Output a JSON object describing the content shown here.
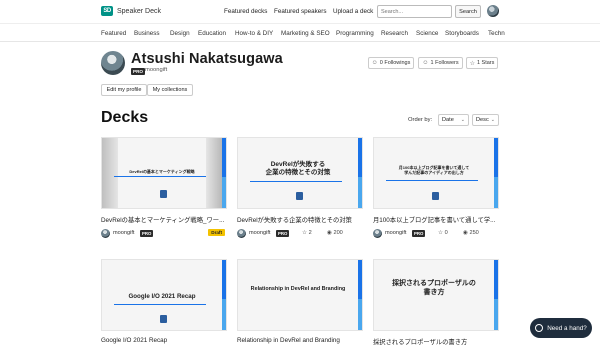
{
  "header": {
    "logo_mark": "SD",
    "logo_text": "Speaker Deck",
    "links": [
      "Featured decks",
      "Featured speakers",
      "Upload a deck"
    ],
    "search_placeholder": "Search...",
    "search_button": "Search"
  },
  "categories": [
    "Featured",
    "Business",
    "Design",
    "Education",
    "How-to & DIY",
    "Marketing & SEO",
    "Programming",
    "Research",
    "Science",
    "Storyboards",
    "Techn"
  ],
  "profile": {
    "name": "Atsushi Nakatsugawa",
    "pro_label": "PRO",
    "username": "moongift",
    "followings": "0 Followings",
    "followers": "1 Followers",
    "stars": "1 Stars",
    "edit_profile": "Edit my profile",
    "collections": "My collections"
  },
  "decks": {
    "title": "Decks",
    "order_label": "Order by:",
    "order_value": "Date",
    "direction_value": "Desc"
  },
  "cards": [
    {
      "slide": "DevRelの基本とマーケティング戦略",
      "title": "DevRelの基本とマーケティング戦略_ワー...",
      "user": "moongift",
      "pro": "PRO",
      "stars": "",
      "views": "",
      "draft": "Draft"
    },
    {
      "slide": "DevRelが失敗する\n企業の特徴とその対策",
      "title": "DevRelが失敗する企業の特徴とその対策",
      "user": "moongift",
      "pro": "PRO",
      "stars": "2",
      "views": "200",
      "draft": ""
    },
    {
      "slide": "月100本以上ブログ記事を書いて通して\n学んだ記事のアイディアの出し方",
      "title": "月100本以上ブログ記事を書いて通して学...",
      "user": "moongift",
      "pro": "PRO",
      "stars": "0",
      "views": "250",
      "draft": ""
    },
    {
      "slide": "Google I/O 2021 Recap",
      "title": "Google I/O 2021 Recap",
      "user": "",
      "pro": "",
      "stars": "",
      "views": "",
      "draft": ""
    },
    {
      "slide": "Relationship in DevRel and Branding",
      "title": "Relationship in DevRel and Branding",
      "user": "",
      "pro": "",
      "stars": "",
      "views": "",
      "draft": ""
    },
    {
      "slide": "採択されるプロポーザルの\n書き方",
      "title": "採択されるプロポーザルの書き方",
      "user": "",
      "pro": "",
      "stars": "",
      "views": "",
      "draft": ""
    }
  ],
  "help": {
    "label": "Need a hand?"
  },
  "colors": {
    "brand": "#009287",
    "accent": "#1a73e8",
    "draft": "#f3c200",
    "help_bg": "#1f2d3d"
  }
}
